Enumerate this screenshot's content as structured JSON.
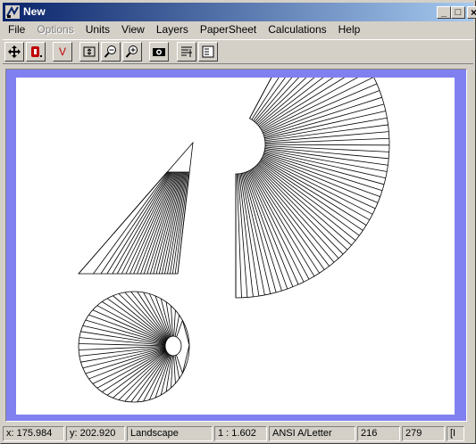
{
  "window": {
    "title": "New"
  },
  "titlebar_buttons": {
    "minimize": "_",
    "maximize": "□",
    "close": "×"
  },
  "menu": [
    "File",
    "Options",
    "Units",
    "View",
    "Layers",
    "PaperSheet",
    "Calculations",
    "Help"
  ],
  "toolbar": {
    "tools": [
      {
        "name": "move-tool",
        "icon": "move-icon"
      },
      {
        "name": "stop-tool",
        "icon": "stop-icon"
      },
      {
        "name": "v-tool",
        "icon": "v-icon",
        "label": "V"
      },
      {
        "name": "fit-tool",
        "icon": "fit-icon"
      },
      {
        "name": "zoom-out-tool",
        "icon": "zoom-out-icon"
      },
      {
        "name": "zoom-in-tool",
        "icon": "zoom-in-icon"
      },
      {
        "name": "camera-tool",
        "icon": "camera-icon"
      },
      {
        "name": "align-tool",
        "icon": "align-icon"
      },
      {
        "name": "text-tool",
        "icon": "text-icon"
      }
    ]
  },
  "status": {
    "x": "x: 175.984",
    "y": "y: 202.920",
    "orientation": "Landscape",
    "scale": "1 : 1.602",
    "paper": "ANSI A/Letter",
    "field1": "216",
    "field2": "279",
    "field3": "[I"
  },
  "colors": {
    "frame": "#8080f0",
    "titlebar_start": "#0a246a",
    "titlebar_end": "#a6caf0"
  }
}
